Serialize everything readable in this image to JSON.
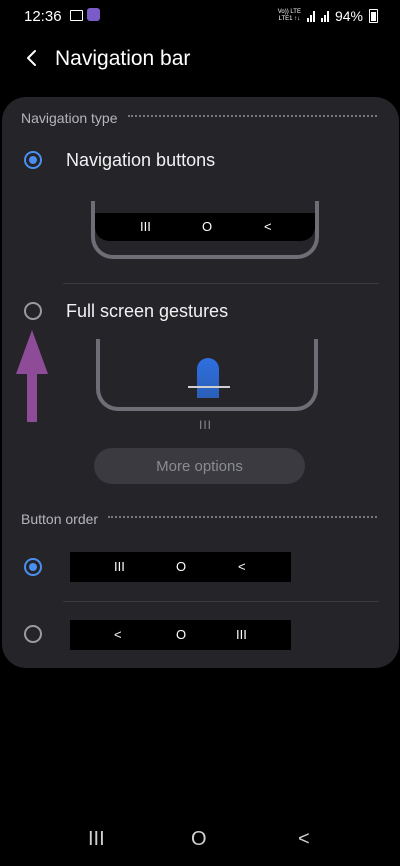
{
  "status": {
    "time": "12:36",
    "net_top": "Vo)) LTE",
    "net_bottom": "LTE1 ↑↓",
    "battery": "94%"
  },
  "header": {
    "title": "Navigation bar"
  },
  "navigation_type": {
    "section_label": "Navigation type",
    "option_buttons_label": "Navigation buttons",
    "option_gestures_label": "Full screen gestures",
    "selected": "Navigation buttons",
    "more_options_label": "More options"
  },
  "button_order": {
    "section_label": "Button order",
    "selected_index": 0
  },
  "glyphs": {
    "recents": "III",
    "home": "O",
    "back": "<"
  },
  "colors": {
    "accent": "#4a8ff0",
    "annotation_arrow": "#8e4c98",
    "card": "#242429"
  }
}
